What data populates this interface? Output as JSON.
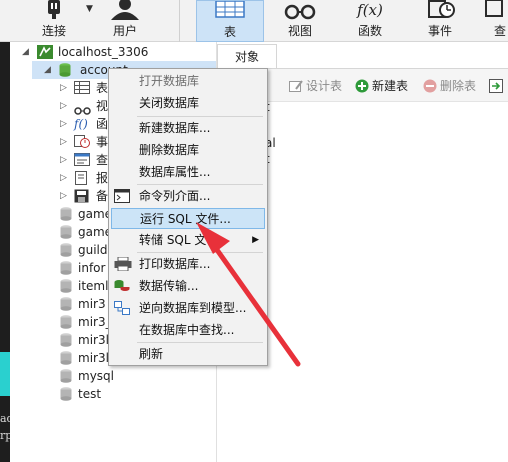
{
  "toolbar": {
    "buttons": [
      {
        "label": "连接",
        "icon": "connect-icon"
      },
      {
        "label": "用户",
        "icon": "user-icon"
      },
      {
        "label": "表",
        "icon": "table-icon"
      },
      {
        "label": "视图",
        "icon": "view-icon"
      },
      {
        "label": "函数",
        "icon": "function-icon"
      },
      {
        "label": "事件",
        "icon": "event-icon"
      },
      {
        "label": "查",
        "icon": "query-icon"
      }
    ],
    "active": "表"
  },
  "tree": {
    "connection": "localhost_3306",
    "selected_db": "account",
    "children": [
      {
        "label": "表",
        "icon": "table-icon"
      },
      {
        "label": "视",
        "icon": "view-icon"
      },
      {
        "label": "函",
        "icon": "function-icon"
      },
      {
        "label": "事",
        "icon": "event-icon"
      },
      {
        "label": "查",
        "icon": "query-icon"
      },
      {
        "label": "报",
        "icon": "report-icon"
      },
      {
        "label": "备",
        "icon": "backup-icon"
      }
    ],
    "databases": [
      "game",
      "game",
      "guild",
      "infor",
      "iteml",
      "mir3",
      "mir3_",
      "mir3l",
      "mir3l",
      "mysql",
      "test"
    ]
  },
  "right_pane": {
    "tab": "对象",
    "toolbar": [
      {
        "label": "设计表",
        "icon": "design-table-icon"
      },
      {
        "label": "新建表",
        "icon": "new-table-icon"
      },
      {
        "label": "删除表",
        "icon": "delete-table-icon"
      }
    ],
    "fragments": [
      "t",
      "al",
      "t"
    ]
  },
  "context_menu": {
    "items": [
      {
        "label": "打开数据库",
        "disabled": true
      },
      {
        "label": "关闭数据库",
        "disabled": false
      },
      {
        "label": "新建数据库...",
        "disabled": false
      },
      {
        "label": "删除数据库",
        "disabled": false
      },
      {
        "label": "数据库属性...",
        "disabled": false
      },
      {
        "label": "命令列介面...",
        "disabled": false,
        "icon": "console-icon"
      },
      {
        "label": "运行 SQL 文件...",
        "disabled": false,
        "highlighted": true
      },
      {
        "label": "转储 SQL 文件",
        "disabled": false,
        "submenu": true
      },
      {
        "label": "打印数据库...",
        "disabled": false,
        "icon": "printer-icon"
      },
      {
        "label": "数据传输...",
        "disabled": false,
        "icon": "data-transfer-icon"
      },
      {
        "label": "逆向数据库到模型...",
        "disabled": false,
        "icon": "reverse-model-icon"
      },
      {
        "label": "在数据库中查找...",
        "disabled": false
      },
      {
        "label": "刷新",
        "disabled": false
      }
    ]
  },
  "edge_text": [
    "ad",
    "rp"
  ],
  "colors": {
    "highlight_bg": "#cce4f7",
    "highlight_border": "#7fb8e8",
    "arrow": "#e8313a",
    "db_icon": "#b4b4b4"
  }
}
